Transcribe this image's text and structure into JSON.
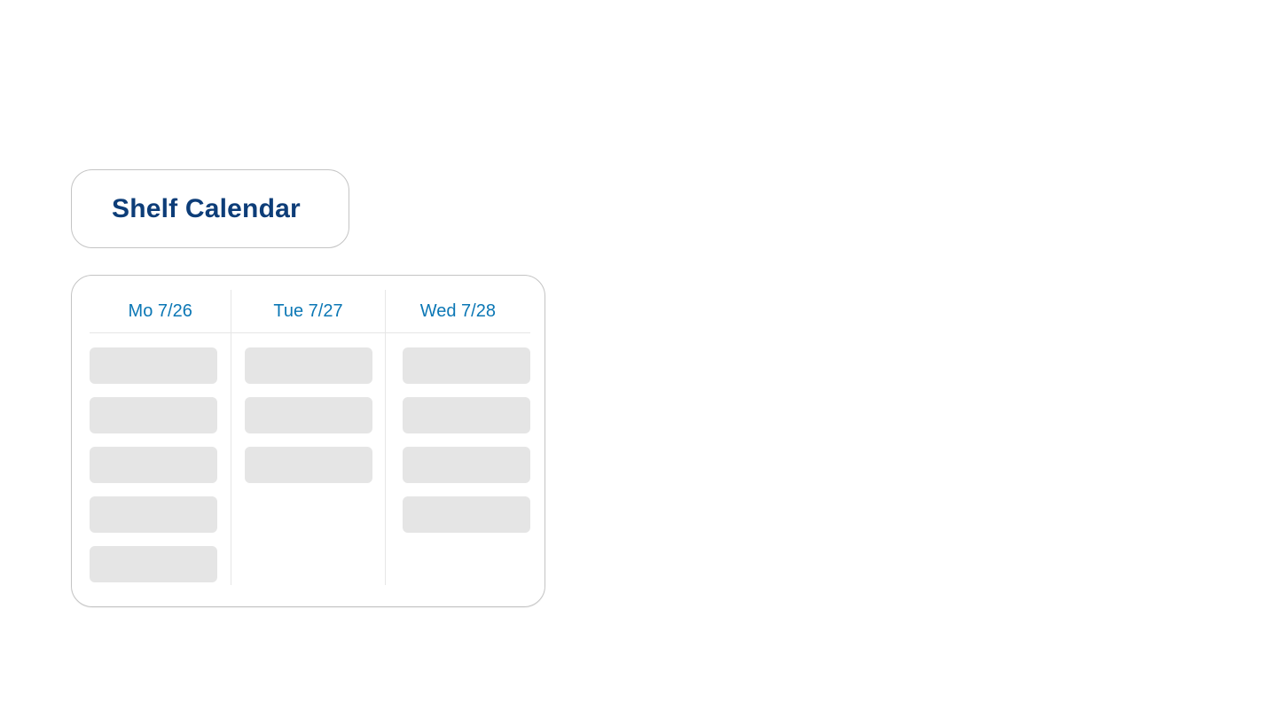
{
  "header": {
    "title": "Shelf Calendar"
  },
  "calendar": {
    "days": [
      {
        "label": "Mo 7/26",
        "slot_count": 5
      },
      {
        "label": "Tue 7/27",
        "slot_count": 3
      },
      {
        "label": "Wed 7/28",
        "slot_count": 4
      }
    ]
  },
  "colors": {
    "title": "#0d3d78",
    "day_header": "#0b77b5",
    "slot_placeholder": "#e5e5e5",
    "border": "#c4c4c4"
  }
}
